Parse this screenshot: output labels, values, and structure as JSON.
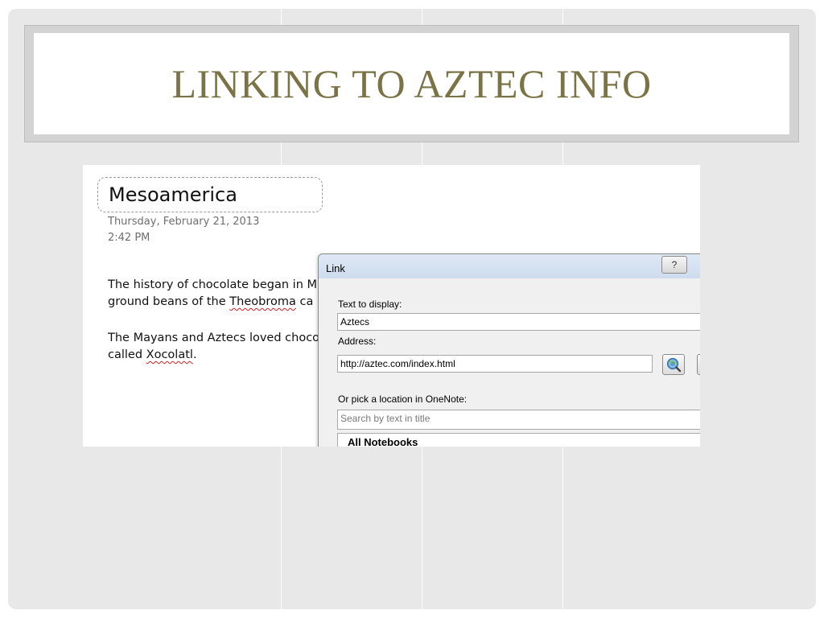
{
  "slide": {
    "title": "LINKING TO AZTEC INFO"
  },
  "note": {
    "page_title": "Mesoamerica",
    "date": "Thursday, February 21, 2013",
    "time": "2:42 PM",
    "para1_line1": "The history of chocolate began in M",
    "para1_line2_pre": "ground beans of the ",
    "para1_line2_word": "Theobroma",
    "para1_line2_post": " ca",
    "para2_line1": "The Mayans and Aztecs loved choco",
    "para2_line2_pre": "called ",
    "para2_line2_word": "Xocolatl",
    "para2_line2_post": "."
  },
  "dialog": {
    "title": "Link",
    "help_label": "?",
    "text_to_display_label": "Text to display:",
    "text_to_display_value": "Aztecs",
    "address_label": "Address:",
    "address_value": "http://aztec.com/index.html",
    "pick_location_label": "Or pick a location in OneNote:",
    "search_placeholder": "Search by text in title",
    "tree_root": "All Notebooks"
  },
  "icons": {
    "browse_web": "globe-search-icon"
  },
  "colors": {
    "title": "#7a7346",
    "slide_bg": "#e8e8e8",
    "spell_error": "#d02020"
  }
}
